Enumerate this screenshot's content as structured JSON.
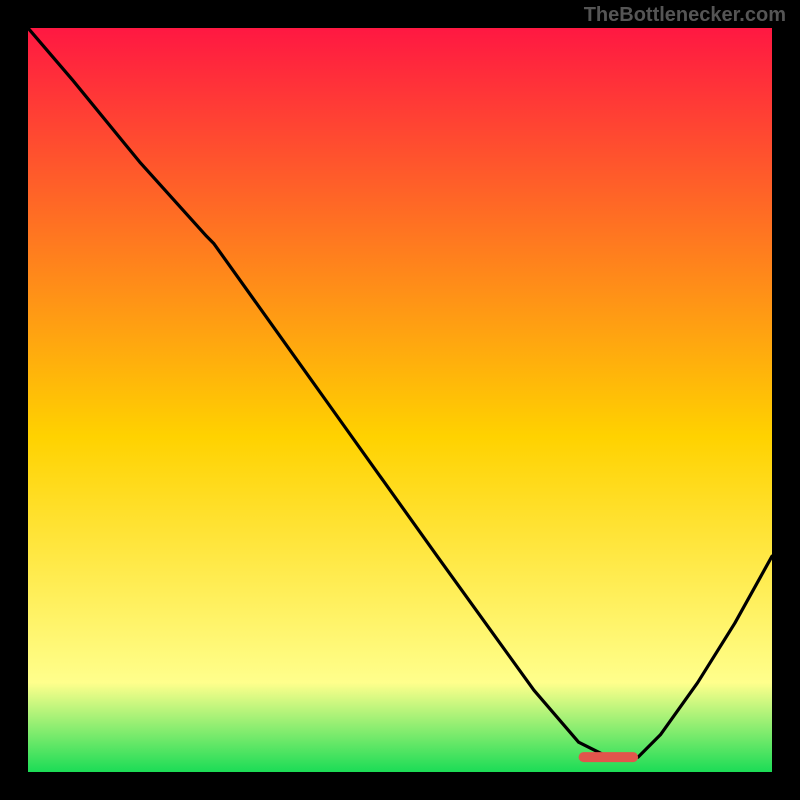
{
  "watermark": "TheBottlenecker.com",
  "chart_data": {
    "type": "line",
    "title": "",
    "xlabel": "",
    "ylabel": "",
    "xlim": [
      0,
      100
    ],
    "ylim": [
      0,
      100
    ],
    "gradient": {
      "top": "#ff1842",
      "mid": "#ffd200",
      "low": "#ffff8c",
      "bottom": "#1bdc56"
    },
    "series": [
      {
        "name": "curve",
        "x": [
          0,
          6,
          15,
          24,
          25,
          40,
          55,
          68,
          74,
          78,
          82,
          85,
          90,
          95,
          100
        ],
        "y": [
          100,
          93,
          82,
          72,
          71,
          50,
          29,
          11,
          4,
          2,
          2,
          5,
          12,
          20,
          29
        ]
      }
    ],
    "marker": {
      "name": "optimal-zone",
      "x_start": 74,
      "x_end": 82,
      "y": 2,
      "color": "#e2554c"
    }
  }
}
